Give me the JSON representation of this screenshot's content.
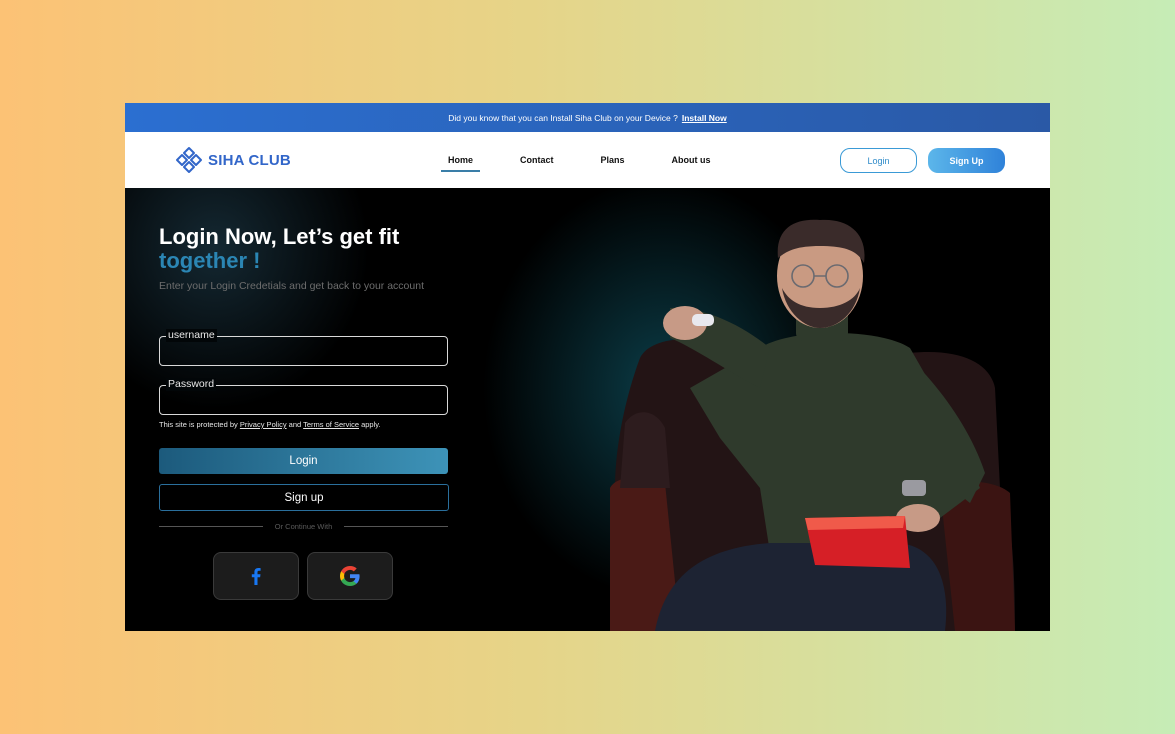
{
  "banner": {
    "text": "Did you know that you can Install Siha Club on your Device ?",
    "link": "Install Now"
  },
  "brand": {
    "name": "SIHA CLUB",
    "icon": "logo-icon",
    "color": "#3266c9"
  },
  "nav": {
    "links": [
      "Home",
      "Contact",
      "Plans",
      "About us"
    ],
    "active": "Home",
    "login_label": "Login",
    "signup_label": "Sign Up"
  },
  "hero": {
    "title_line1": "Login Now, Let’s get fit",
    "title_line2": "together !",
    "subtitle": "Enter your Login Credetials and get back to your account",
    "username_label": "username",
    "password_label": "Password",
    "legal_prefix": "This site is protected by",
    "privacy_link": "Privacy Policy",
    "legal_and": "and",
    "terms_link": "Terms of Service",
    "legal_suffix": "apply.",
    "login_button": "Login",
    "signup_button": "Sign up",
    "divider_text": "Or Continue With",
    "social": [
      "facebook-icon",
      "google-icon"
    ]
  },
  "colors": {
    "accent": "#2b86b4",
    "banner": "#2b6fd1",
    "signup_gradient_end": "#2f82d9"
  }
}
